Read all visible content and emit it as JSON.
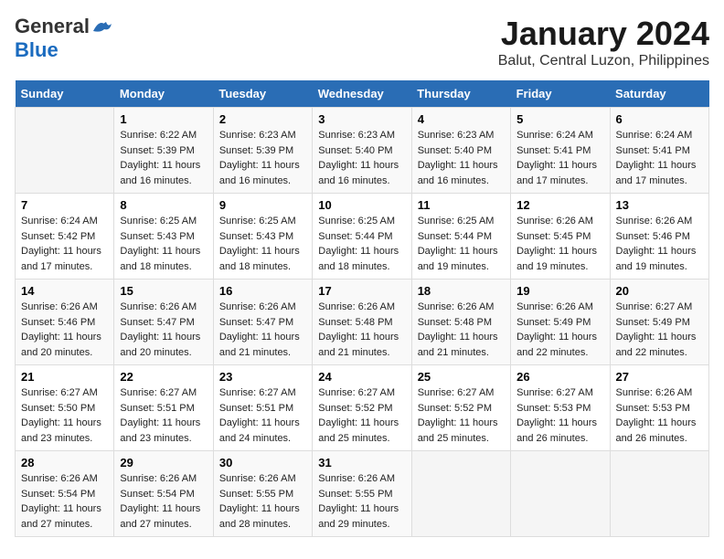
{
  "logo": {
    "line1_general": "General",
    "line2_blue": "Blue"
  },
  "title": {
    "month": "January 2024",
    "location": "Balut, Central Luzon, Philippines"
  },
  "days_header": [
    "Sunday",
    "Monday",
    "Tuesday",
    "Wednesday",
    "Thursday",
    "Friday",
    "Saturday"
  ],
  "weeks": [
    [
      {
        "num": "",
        "sunrise": "",
        "sunset": "",
        "daylight": ""
      },
      {
        "num": "1",
        "sunrise": "Sunrise: 6:22 AM",
        "sunset": "Sunset: 5:39 PM",
        "daylight": "Daylight: 11 hours and 16 minutes."
      },
      {
        "num": "2",
        "sunrise": "Sunrise: 6:23 AM",
        "sunset": "Sunset: 5:39 PM",
        "daylight": "Daylight: 11 hours and 16 minutes."
      },
      {
        "num": "3",
        "sunrise": "Sunrise: 6:23 AM",
        "sunset": "Sunset: 5:40 PM",
        "daylight": "Daylight: 11 hours and 16 minutes."
      },
      {
        "num": "4",
        "sunrise": "Sunrise: 6:23 AM",
        "sunset": "Sunset: 5:40 PM",
        "daylight": "Daylight: 11 hours and 16 minutes."
      },
      {
        "num": "5",
        "sunrise": "Sunrise: 6:24 AM",
        "sunset": "Sunset: 5:41 PM",
        "daylight": "Daylight: 11 hours and 17 minutes."
      },
      {
        "num": "6",
        "sunrise": "Sunrise: 6:24 AM",
        "sunset": "Sunset: 5:41 PM",
        "daylight": "Daylight: 11 hours and 17 minutes."
      }
    ],
    [
      {
        "num": "7",
        "sunrise": "Sunrise: 6:24 AM",
        "sunset": "Sunset: 5:42 PM",
        "daylight": "Daylight: 11 hours and 17 minutes."
      },
      {
        "num": "8",
        "sunrise": "Sunrise: 6:25 AM",
        "sunset": "Sunset: 5:43 PM",
        "daylight": "Daylight: 11 hours and 18 minutes."
      },
      {
        "num": "9",
        "sunrise": "Sunrise: 6:25 AM",
        "sunset": "Sunset: 5:43 PM",
        "daylight": "Daylight: 11 hours and 18 minutes."
      },
      {
        "num": "10",
        "sunrise": "Sunrise: 6:25 AM",
        "sunset": "Sunset: 5:44 PM",
        "daylight": "Daylight: 11 hours and 18 minutes."
      },
      {
        "num": "11",
        "sunrise": "Sunrise: 6:25 AM",
        "sunset": "Sunset: 5:44 PM",
        "daylight": "Daylight: 11 hours and 19 minutes."
      },
      {
        "num": "12",
        "sunrise": "Sunrise: 6:26 AM",
        "sunset": "Sunset: 5:45 PM",
        "daylight": "Daylight: 11 hours and 19 minutes."
      },
      {
        "num": "13",
        "sunrise": "Sunrise: 6:26 AM",
        "sunset": "Sunset: 5:46 PM",
        "daylight": "Daylight: 11 hours and 19 minutes."
      }
    ],
    [
      {
        "num": "14",
        "sunrise": "Sunrise: 6:26 AM",
        "sunset": "Sunset: 5:46 PM",
        "daylight": "Daylight: 11 hours and 20 minutes."
      },
      {
        "num": "15",
        "sunrise": "Sunrise: 6:26 AM",
        "sunset": "Sunset: 5:47 PM",
        "daylight": "Daylight: 11 hours and 20 minutes."
      },
      {
        "num": "16",
        "sunrise": "Sunrise: 6:26 AM",
        "sunset": "Sunset: 5:47 PM",
        "daylight": "Daylight: 11 hours and 21 minutes."
      },
      {
        "num": "17",
        "sunrise": "Sunrise: 6:26 AM",
        "sunset": "Sunset: 5:48 PM",
        "daylight": "Daylight: 11 hours and 21 minutes."
      },
      {
        "num": "18",
        "sunrise": "Sunrise: 6:26 AM",
        "sunset": "Sunset: 5:48 PM",
        "daylight": "Daylight: 11 hours and 21 minutes."
      },
      {
        "num": "19",
        "sunrise": "Sunrise: 6:26 AM",
        "sunset": "Sunset: 5:49 PM",
        "daylight": "Daylight: 11 hours and 22 minutes."
      },
      {
        "num": "20",
        "sunrise": "Sunrise: 6:27 AM",
        "sunset": "Sunset: 5:49 PM",
        "daylight": "Daylight: 11 hours and 22 minutes."
      }
    ],
    [
      {
        "num": "21",
        "sunrise": "Sunrise: 6:27 AM",
        "sunset": "Sunset: 5:50 PM",
        "daylight": "Daylight: 11 hours and 23 minutes."
      },
      {
        "num": "22",
        "sunrise": "Sunrise: 6:27 AM",
        "sunset": "Sunset: 5:51 PM",
        "daylight": "Daylight: 11 hours and 23 minutes."
      },
      {
        "num": "23",
        "sunrise": "Sunrise: 6:27 AM",
        "sunset": "Sunset: 5:51 PM",
        "daylight": "Daylight: 11 hours and 24 minutes."
      },
      {
        "num": "24",
        "sunrise": "Sunrise: 6:27 AM",
        "sunset": "Sunset: 5:52 PM",
        "daylight": "Daylight: 11 hours and 25 minutes."
      },
      {
        "num": "25",
        "sunrise": "Sunrise: 6:27 AM",
        "sunset": "Sunset: 5:52 PM",
        "daylight": "Daylight: 11 hours and 25 minutes."
      },
      {
        "num": "26",
        "sunrise": "Sunrise: 6:27 AM",
        "sunset": "Sunset: 5:53 PM",
        "daylight": "Daylight: 11 hours and 26 minutes."
      },
      {
        "num": "27",
        "sunrise": "Sunrise: 6:26 AM",
        "sunset": "Sunset: 5:53 PM",
        "daylight": "Daylight: 11 hours and 26 minutes."
      }
    ],
    [
      {
        "num": "28",
        "sunrise": "Sunrise: 6:26 AM",
        "sunset": "Sunset: 5:54 PM",
        "daylight": "Daylight: 11 hours and 27 minutes."
      },
      {
        "num": "29",
        "sunrise": "Sunrise: 6:26 AM",
        "sunset": "Sunset: 5:54 PM",
        "daylight": "Daylight: 11 hours and 27 minutes."
      },
      {
        "num": "30",
        "sunrise": "Sunrise: 6:26 AM",
        "sunset": "Sunset: 5:55 PM",
        "daylight": "Daylight: 11 hours and 28 minutes."
      },
      {
        "num": "31",
        "sunrise": "Sunrise: 6:26 AM",
        "sunset": "Sunset: 5:55 PM",
        "daylight": "Daylight: 11 hours and 29 minutes."
      },
      {
        "num": "",
        "sunrise": "",
        "sunset": "",
        "daylight": ""
      },
      {
        "num": "",
        "sunrise": "",
        "sunset": "",
        "daylight": ""
      },
      {
        "num": "",
        "sunrise": "",
        "sunset": "",
        "daylight": ""
      }
    ]
  ]
}
